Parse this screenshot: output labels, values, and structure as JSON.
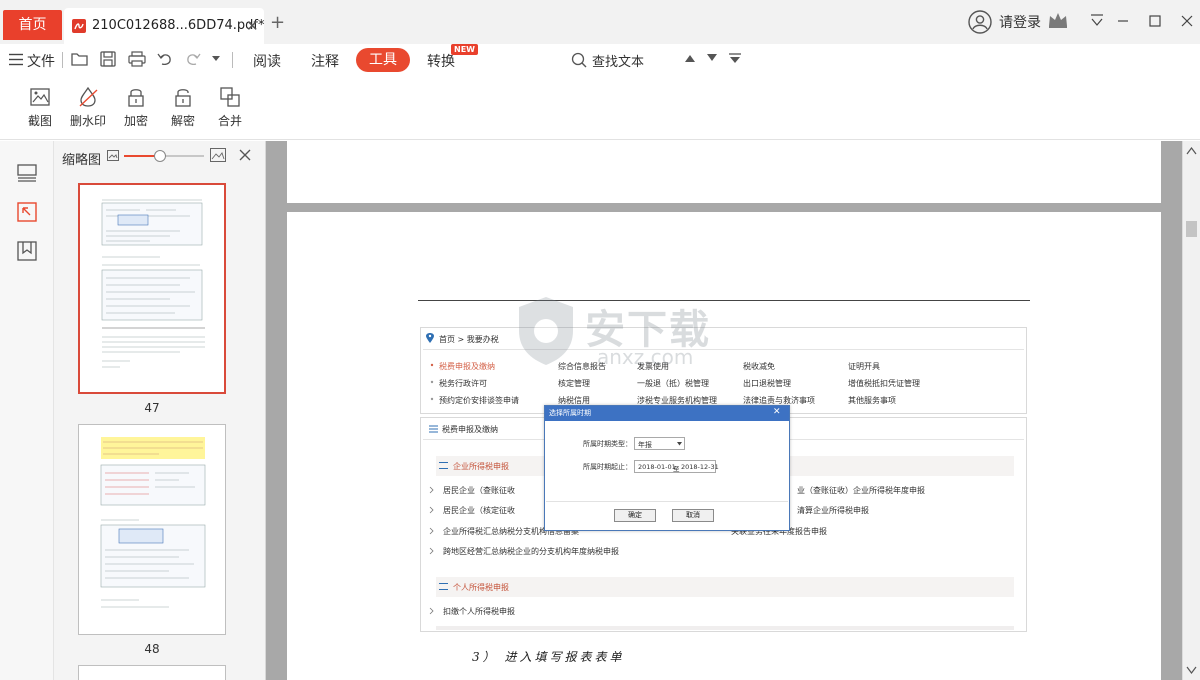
{
  "tabs": {
    "home_label": "首页",
    "doc_title": "210C012688...6DD74.pdf*",
    "close_symbol": "✕",
    "new_tab_symbol": "+"
  },
  "account": {
    "login_label": "请登录"
  },
  "menu": {
    "file_label": "文件",
    "items": [
      "阅读",
      "注释",
      "工具",
      "转换"
    ],
    "new_badge": "NEW",
    "search_label": "查找文本"
  },
  "ribbon": {
    "tools": [
      "截图",
      "删水印",
      "加密",
      "解密",
      "合并"
    ]
  },
  "thumbnails": {
    "header_label": "缩略图",
    "zoom_level": 0.45,
    "pages": [
      "47",
      "48"
    ]
  },
  "document": {
    "breadcrumb": "首页 > 我要办税",
    "services": [
      [
        "税费申报及缴纳",
        "综合信息报告",
        "发票使用",
        "税收减免",
        "证明开具"
      ],
      [
        "税务行政许可",
        "核定管理",
        "一般退（抵）税管理",
        "出口退税管理",
        "增值税抵扣凭证管理"
      ],
      [
        "预约定价安排谈签申请",
        "纳税信用",
        "涉税专业服务机构管理",
        "法律追责与救济事项",
        "其他服务事项"
      ]
    ],
    "panel_title": "税费申报及缴纳",
    "section1_title": "企业所得税申报",
    "section1_items_left": [
      "居民企业（查账征收",
      "居民企业（核定征收",
      "企业所得税汇总纳税分支机构信息备案",
      "跨地区经营汇总纳税企业的分支机构年度纳税申报"
    ],
    "section1_items_right": [
      "业（查账征收）企业所得税年度申报",
      "清算企业所得税申报",
      "关联业务往来年度报告申报"
    ],
    "section2_title": "个人所得税申报",
    "section2_items": [
      "扣缴个人所得税申报"
    ],
    "handwriting": "3）  进入填写报表表单",
    "watermark": "安下载",
    "watermark_sub": "anxz.com"
  },
  "dialog": {
    "title": "选择所属时期",
    "type_label": "所属时期类型：",
    "type_value": "年报",
    "range_label": "所属时期起止：",
    "date_from": "2018-01-01",
    "date_sep": "至",
    "date_to": "2018-12-31",
    "ok_label": "确定",
    "cancel_label": "取消",
    "close_symbol": "✕"
  },
  "colors": {
    "accent": "#e9492f",
    "home_tab": "#e9402c",
    "dialog_title": "#3d72c3",
    "selected_thumb": "#d94a3a",
    "section_title": "#c5533a"
  }
}
